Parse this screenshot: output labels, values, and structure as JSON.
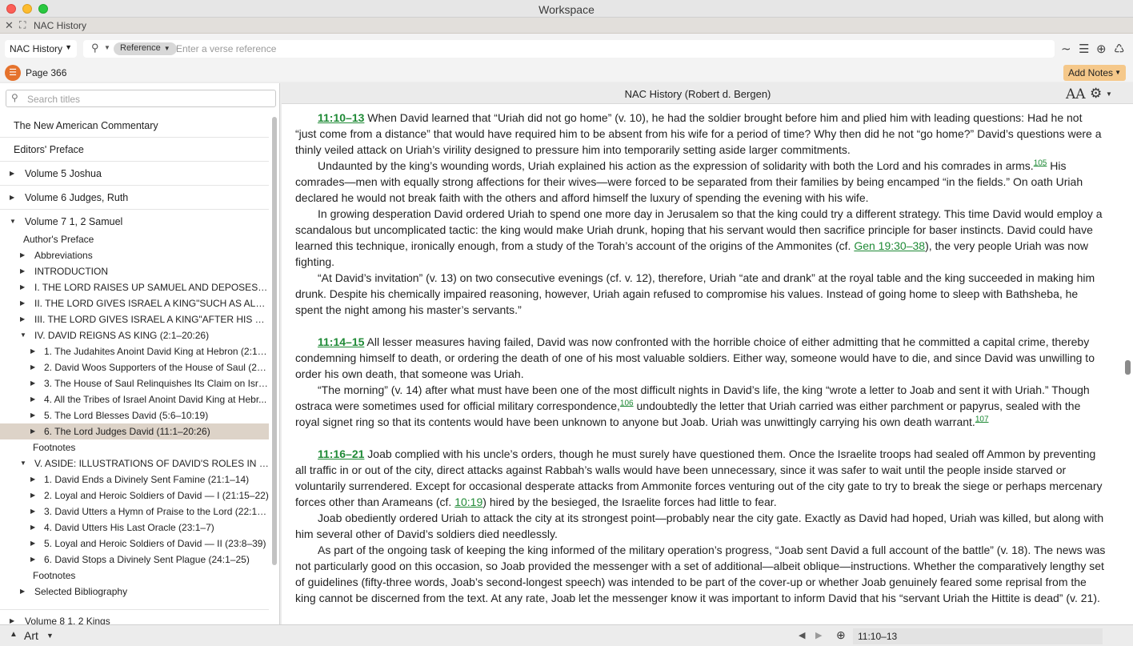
{
  "window": {
    "title": "Workspace"
  },
  "tab": {
    "title": "NAC History"
  },
  "toolbar": {
    "resource": "NAC History",
    "search_type": "Reference",
    "verse_placeholder": "Enter a verse reference"
  },
  "pagebar": {
    "page": "Page 366",
    "add_notes": "Add Notes"
  },
  "sidebar": {
    "search_placeholder": "Search titles",
    "top_items": [
      "The New American Commentary",
      "Editors' Preface",
      "Volume 5 Joshua",
      "Volume 6 Judges, Ruth",
      "Volume 7 1, 2 Samuel"
    ],
    "items": [
      "Author's Preface",
      "Abbreviations",
      "INTRODUCTION",
      "I. THE LORD RAISES UP SAMUEL AND DEPOSES TH...",
      "II. THE LORD GIVES ISRAEL A KING\"SUCH AS ALL O...",
      "III. THE LORD GIVES ISRAEL A KING\"AFTER HIS OW...",
      "IV. DAVID REIGNS AS KING (2:1–20:26)",
      "1. The Judahites Anoint David King at Hebron (2:1–...",
      "2. David Woos Supporters of the House of Saul (2:4...",
      "3. The House of Saul Relinquishes Its Claim on Israe...",
      "4. All the Tribes of Israel Anoint David King at Hebr...",
      "5. The Lord Blesses David (5:6–10:19)",
      "6. The Lord Judges David (11:1–20:26)",
      "Footnotes",
      "V. ASIDE: ILLUSTRATIONS OF DAVID'S ROLES IN HI...",
      "1. David Ends a Divinely Sent Famine (21:1–14)",
      "2. Loyal and Heroic Soldiers of David — I (21:15–22)",
      "3. David Utters a Hymn of Praise to the Lord (22:1–...",
      "4. David Utters His Last Oracle (23:1–7)",
      "5. Loyal and Heroic Soldiers of David — II (23:8–39)",
      "6. David Stops a Divinely Sent Plague (24:1–25)",
      "Footnotes",
      "Selected Bibliography",
      "Volume 8 1, 2 Kings"
    ]
  },
  "doc": {
    "title": "NAC History (Robert d. Bergen)",
    "font_btn": "AA",
    "s1_ref": "11:10–13",
    "s1_p1": "When David learned that “Uriah did not go home” (v. 10), he had the soldier brought before him and plied him with leading questions: Had he not “just come from a distance” that would have required him to be absent from his wife for a period of time? Why then did he not “go home?” David’s questions were a thinly veiled attack on Uriah’s virility designed to pressure him into temporarily setting aside larger commitments.",
    "s1_p2a": "Undaunted by the king’s wounding words, Uriah explained his action as the expression of solidarity with both the Lord and his comrades in arms.",
    "fn105": "105",
    "s1_p2b": " His comrades—men with equally strong affections for their wives—were forced to be separated from their families by being encamped “in the fields.” On oath Uriah declared he would not break faith with the others and afford himself the luxury of spending the evening with his wife.",
    "s1_p3a": "In growing desperation David ordered Uriah to spend one more day in Jerusalem so that the king could try a different strategy. This time David would employ a scandalous but uncomplicated tactic: the king would make Uriah drunk, hoping that his servant would then sacrifice principle for baser instincts. David could have learned this technique, ironically enough, from a study of the Torah’s account of the origins of the Ammonites (cf. ",
    "link_gen": "Gen 19:30–38",
    "s1_p3b": "), the very people Uriah was now fighting.",
    "s1_p4": "“At David’s invitation” (v. 13) on two consecutive evenings (cf. v. 12), therefore, Uriah “ate and drank” at the royal table and the king succeeded in making him drunk. Despite his chemically impaired reasoning, however, Uriah again refused to compromise his values. Instead of going home to sleep with Bathsheba, he spent the night among his master’s servants.”",
    "s2_ref": "11:14–15",
    "s2_p1": "All lesser measures having failed, David was now confronted with the horrible choice of either admitting that he committed a capital crime, thereby condemning himself to death, or ordering the death of one of his most valuable soldiers. Either way, someone would have to die, and since David was unwilling to order his own death, that someone was Uriah.",
    "s2_p2a": "“The morning” (v. 14) after what must have been one of the most difficult nights in David’s life, the king “wrote a letter to Joab and sent it with Uriah.” Though ostraca were sometimes used for official military correspondence,",
    "fn106": "106",
    "s2_p2b": " undoubtedly the letter that Uriah carried was either parchment or papyrus, sealed with the royal signet ring so that its contents would have been unknown to anyone but Joab. Uriah was unwittingly carrying his own death warrant.",
    "fn107": "107",
    "s3_ref": "11:16–21",
    "s3_p1a": "Joab complied with his uncle’s orders, though he must surely have questioned them. Once the Israelite troops had sealed off Ammon by preventing all traffic in or out of the city, direct attacks against Rabbah’s walls would have been unnecessary, since it was safer to wait until the people inside starved or voluntarily surrendered. Except for occasional desperate attacks from Ammonite forces venturing out of the city gate to try to break the siege or perhaps mercenary forces other than Arameans (cf. ",
    "link_1019": "10:19",
    "s3_p1b": ") hired by the besieged, the Israelite forces had little to fear.",
    "s3_p2": "Joab obediently ordered Uriah to attack the city at its strongest point—probably near the city gate. Exactly as David had hoped, Uriah was killed, but along with him several other of David’s soldiers died needlessly.",
    "s3_p3": "As part of the ongoing task of keeping the king informed of the military operation’s progress, “Joab sent David a full account of the battle” (v. 18). The news was not particularly good on this occasion, so Joab provided the messenger with a set of additional—albeit oblique—instructions. Whether the comparatively lengthy set of guidelines (fifty-three words, Joab’s second-longest speech) was intended to be part of the cover-up or whether Joab genuinely feared some reprisal from the king cannot be discerned from the text. At any rate, Joab let the messenger know it was important to inform David that his “servant Uriah the Hittite is dead” (v. 21)."
  },
  "bottombar": {
    "layout": "Art",
    "reference": "11:10–13"
  }
}
